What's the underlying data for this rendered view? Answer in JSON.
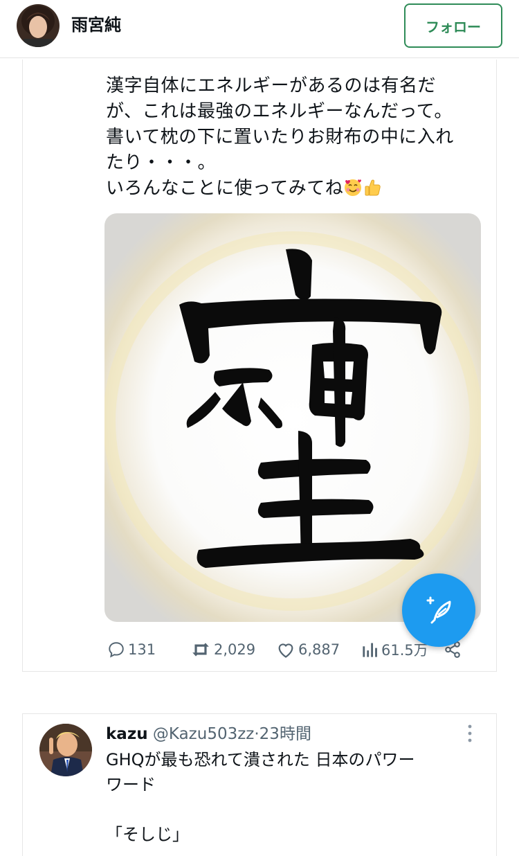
{
  "header": {
    "name": "雨宮純",
    "follow_label": "フォロー"
  },
  "tweet1": {
    "lines": [
      "漢字自体にエネルギーがあるのは有名だ",
      "が、これは最強のエネルギーなんだって。",
      "書いて枕の下に置いたりお財布の中に入れ",
      "たり・・・。",
      "いろんなことに使ってみてね"
    ],
    "emojis": [
      "smiling-face-with-hearts",
      "thumbs-up"
    ],
    "image_alt": "calligraphy-kanji-image",
    "stats": {
      "replies": "131",
      "retweets": "2,029",
      "likes": "6,887",
      "views": "61.5万"
    },
    "icons": [
      "reply-icon",
      "retweet-icon",
      "like-icon",
      "views-icon",
      "share-icon",
      "compose-icon"
    ],
    "colors": {
      "fab": "#1d9bf0",
      "follow": "#2e8b57",
      "muted": "#536471"
    }
  },
  "tweet2": {
    "username": "kazu",
    "handle": "@Kazu503zz",
    "separator": "·",
    "time": "23時間",
    "lines": [
      "GHQが最も恐れて潰された 日本のパワー",
      "ワード",
      "",
      "「そしじ」"
    ]
  }
}
